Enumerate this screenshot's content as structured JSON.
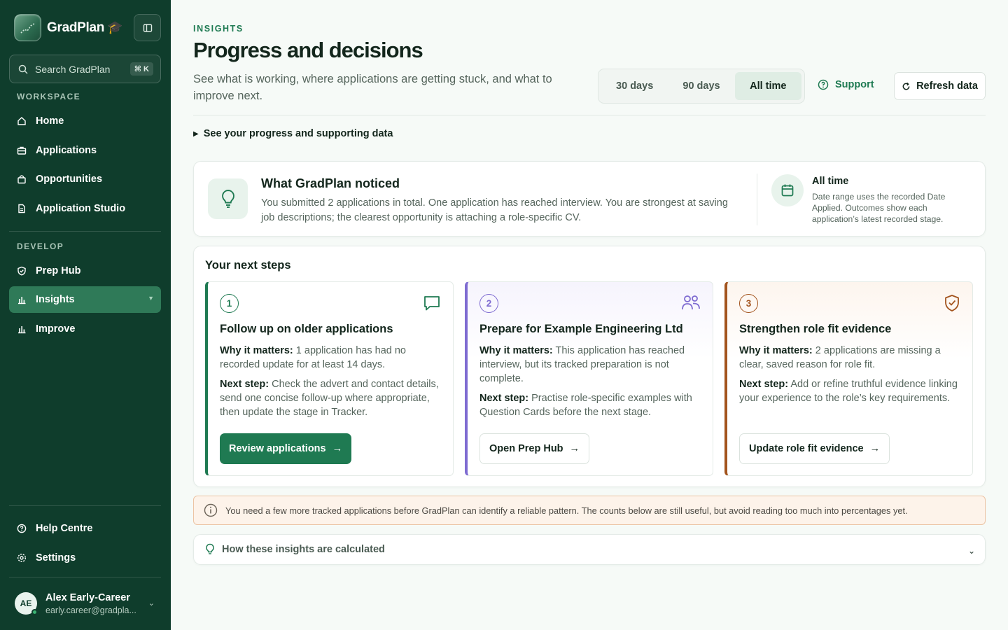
{
  "sidebar": {
    "brand": "GradPlan",
    "brand_emoji": "🎓",
    "search": {
      "label": "Search GradPlan",
      "shortcut": "⌘ K"
    },
    "workspace_label": "WORKSPACE",
    "workspace_items": [
      {
        "label": "Home",
        "icon": "home-icon"
      },
      {
        "label": "Applications",
        "icon": "briefcase-icon"
      },
      {
        "label": "Opportunities",
        "icon": "bag-icon"
      },
      {
        "label": "Application Studio",
        "icon": "document-icon"
      }
    ],
    "develop_label": "DEVELOP",
    "develop_items": [
      {
        "label": "Prep Hub",
        "icon": "shield-check-icon"
      },
      {
        "label": "Insights",
        "icon": "bar-chart-icon",
        "active": true
      },
      {
        "label": "Improve",
        "icon": "bar-chart-icon"
      }
    ],
    "footer_items": [
      {
        "label": "Help Centre",
        "icon": "help-circle-icon"
      },
      {
        "label": "Settings",
        "icon": "gear-icon"
      }
    ],
    "user": {
      "initials": "AE",
      "name": "Alex Early-Career",
      "email": "early.career@gradpla..."
    }
  },
  "header": {
    "eyebrow": "INSIGHTS",
    "title": "Progress and decisions",
    "subtitle": "See what is working, where applications are getting stuck, and what to improve next.",
    "ranges": [
      {
        "label": "30 days",
        "active": false
      },
      {
        "label": "90 days",
        "active": false
      },
      {
        "label": "All time",
        "active": true
      }
    ],
    "support_label": "Support",
    "refresh_label": "Refresh data"
  },
  "disclosure_label": "See your progress and supporting data",
  "noticed": {
    "title": "What GradPlan noticed",
    "body": "You submitted 2 applications in total. One application has reached interview. You are strongest at saving job descriptions; the clearest opportunity is attaching a role-specific CV.",
    "range_title": "All time",
    "range_body": "Date range uses the recorded Date Applied. Outcomes show each application’s latest recorded stage."
  },
  "next_steps": {
    "title": "Your next steps",
    "items": [
      {
        "number": "1",
        "icon": "message-icon",
        "title": "Follow up on older applications",
        "why_label": "Why it matters:",
        "why": "1 application has had no recorded update for at least 14 days.",
        "next_label": "Next step:",
        "next": "Check the advert and contact details, send one concise follow-up where appropriate, then update the stage in Tracker.",
        "button": "Review applications"
      },
      {
        "number": "2",
        "icon": "users-icon",
        "title": "Prepare for Example Engineering Ltd",
        "why_label": "Why it matters:",
        "why": "This application has reached interview, but its tracked preparation is not complete.",
        "next_label": "Next step:",
        "next": "Practise role-specific examples with Question Cards before the next stage.",
        "button": "Open Prep Hub"
      },
      {
        "number": "3",
        "icon": "shield-check-icon",
        "title": "Strengthen role fit evidence",
        "why_label": "Why it matters:",
        "why": "2 applications are missing a clear, saved reason for role fit.",
        "next_label": "Next step:",
        "next": "Add or refine truthful evidence linking your experience to the role’s key requirements.",
        "button": "Update role fit evidence"
      }
    ]
  },
  "notice": "You need a few more tracked applications before GradPlan can identify a reliable pattern. The counts below are still useful, but avoid reading too much into percentages yet.",
  "calc_label": "How these insights are calculated",
  "colors": {
    "sidebar": "#0f3d2c",
    "accent": "#1f7a52",
    "step2": "#7e6bd1",
    "step3": "#a3541e"
  }
}
